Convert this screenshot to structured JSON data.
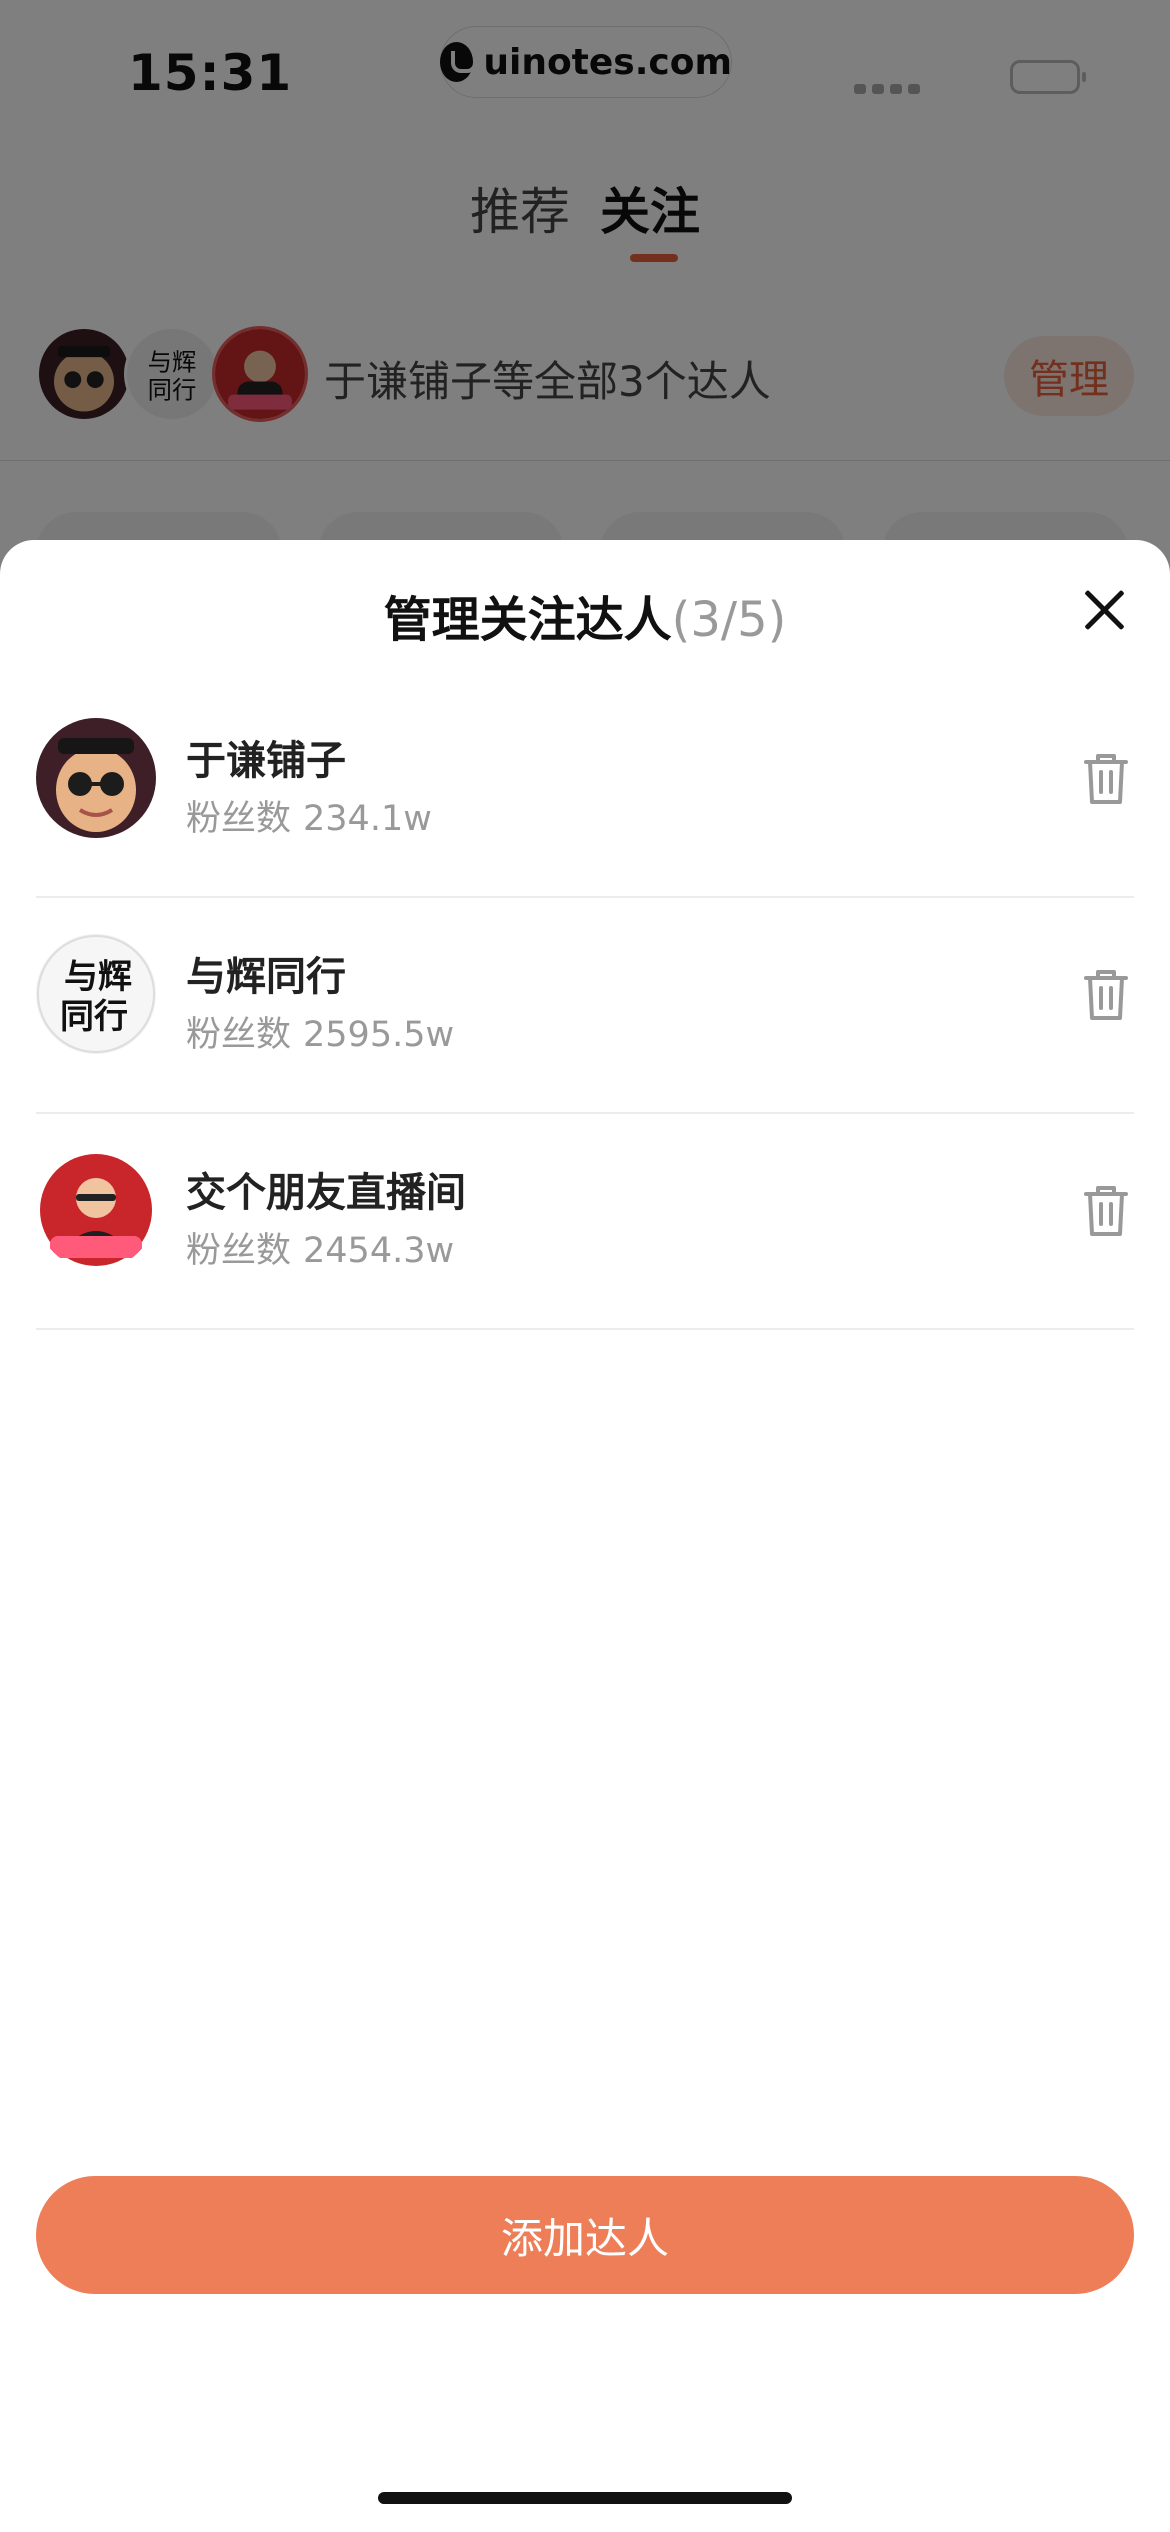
{
  "status_bar": {
    "time": "15:31",
    "url": "uinotes.com"
  },
  "tabs": [
    {
      "label": "推荐"
    },
    {
      "label": "关注"
    }
  ],
  "following_row": {
    "text": "于谦铺子等全部3个达人",
    "manage_label": "管理"
  },
  "sheet": {
    "title": "管理关注达人",
    "count": "(3/5)",
    "fans_label": "粉丝数",
    "influencers": [
      {
        "name": "于谦铺子",
        "fans": "234.1w"
      },
      {
        "name": "与辉同行",
        "fans": "2595.5w"
      },
      {
        "name": "交个朋友直播间",
        "fans": "2454.3w"
      }
    ],
    "add_button_label": "添加达人"
  },
  "colors": {
    "accent": "#e8603c",
    "button": "#ee7e58"
  }
}
